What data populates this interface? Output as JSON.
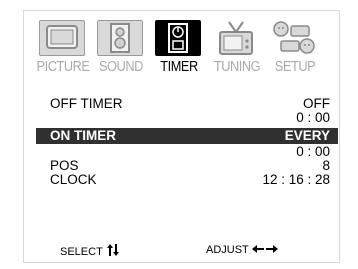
{
  "tabs": [
    {
      "label": "PICTURE",
      "icon": "tv-screen-icon"
    },
    {
      "label": "SOUND",
      "icon": "speaker-icon"
    },
    {
      "label": "TIMER",
      "icon": "timer-icon"
    },
    {
      "label": "TUNING",
      "icon": "antenna-tv-icon"
    },
    {
      "label": "SETUP",
      "icon": "setup-devices-icon"
    }
  ],
  "active_tab": "TIMER",
  "menu": {
    "off_timer": {
      "label": "OFF TIMER",
      "mode": "OFF",
      "time": "0 : 00"
    },
    "on_timer": {
      "label": "ON TIMER",
      "mode": "EVERY",
      "time": "0 : 00"
    },
    "pos": {
      "label": "POS",
      "value": "8"
    },
    "clock": {
      "label": "CLOCK",
      "value": "12 : 16 : 28"
    }
  },
  "footer": {
    "select_label": "SELECT",
    "adjust_label": "ADJUST"
  },
  "colors": {
    "highlight_bg": "#303030",
    "inactive_tab": "#a9a9a9",
    "active_tab": "#000000"
  }
}
